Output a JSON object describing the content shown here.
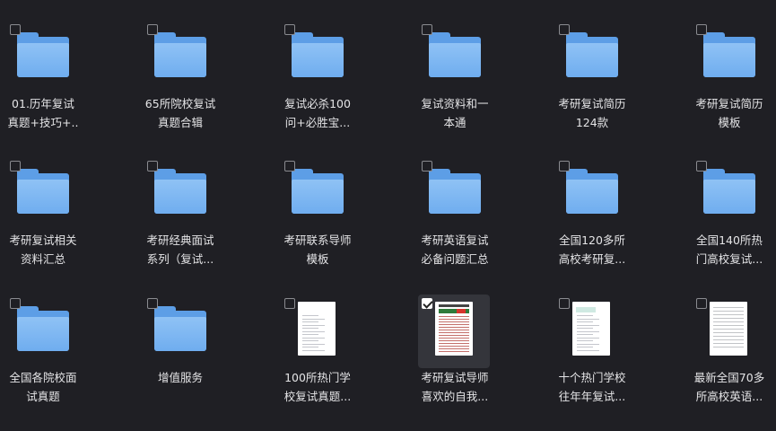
{
  "items": [
    {
      "type": "folder",
      "selected": false,
      "line1": "01.历年复试",
      "line2": "真题+技巧+.."
    },
    {
      "type": "folder",
      "selected": false,
      "line1": "65所院校复试",
      "line2": "真题合辑"
    },
    {
      "type": "folder",
      "selected": false,
      "line1": "复试必杀100",
      "line2": "问+必胜宝..."
    },
    {
      "type": "folder",
      "selected": false,
      "line1": "复试资料和一",
      "line2": "本通"
    },
    {
      "type": "folder",
      "selected": false,
      "line1": "考研复试简历",
      "line2": "124款"
    },
    {
      "type": "folder",
      "selected": false,
      "line1": "考研复试简历",
      "line2": "模板"
    },
    {
      "type": "folder",
      "selected": false,
      "line1": "考研复试相关",
      "line2": "资料汇总"
    },
    {
      "type": "folder",
      "selected": false,
      "line1": "考研经典面试",
      "line2": "系列（复试..."
    },
    {
      "type": "folder",
      "selected": false,
      "line1": "考研联系导师",
      "line2": "模板"
    },
    {
      "type": "folder",
      "selected": false,
      "line1": "考研英语复试",
      "line2": "必备问题汇总"
    },
    {
      "type": "folder",
      "selected": false,
      "line1": "全国120多所",
      "line2": "高校考研复..."
    },
    {
      "type": "folder",
      "selected": false,
      "line1": "全国140所热",
      "line2": "门高校复试..."
    },
    {
      "type": "folder",
      "selected": false,
      "line1": "全国各院校面",
      "line2": "试真题"
    },
    {
      "type": "folder",
      "selected": false,
      "line1": "增值服务",
      "line2": ""
    },
    {
      "type": "doc-plain",
      "selected": false,
      "line1": "100所热门学",
      "line2": "校复试真题..."
    },
    {
      "type": "doc-red",
      "selected": true,
      "line1": "考研复试导师",
      "line2": "喜欢的自我..."
    },
    {
      "type": "doc-green",
      "selected": false,
      "line1": "十个热门学校",
      "line2": "往年年复试..."
    },
    {
      "type": "doc-table",
      "selected": false,
      "line1": "最新全国70多",
      "line2": "所高校英语..."
    }
  ]
}
